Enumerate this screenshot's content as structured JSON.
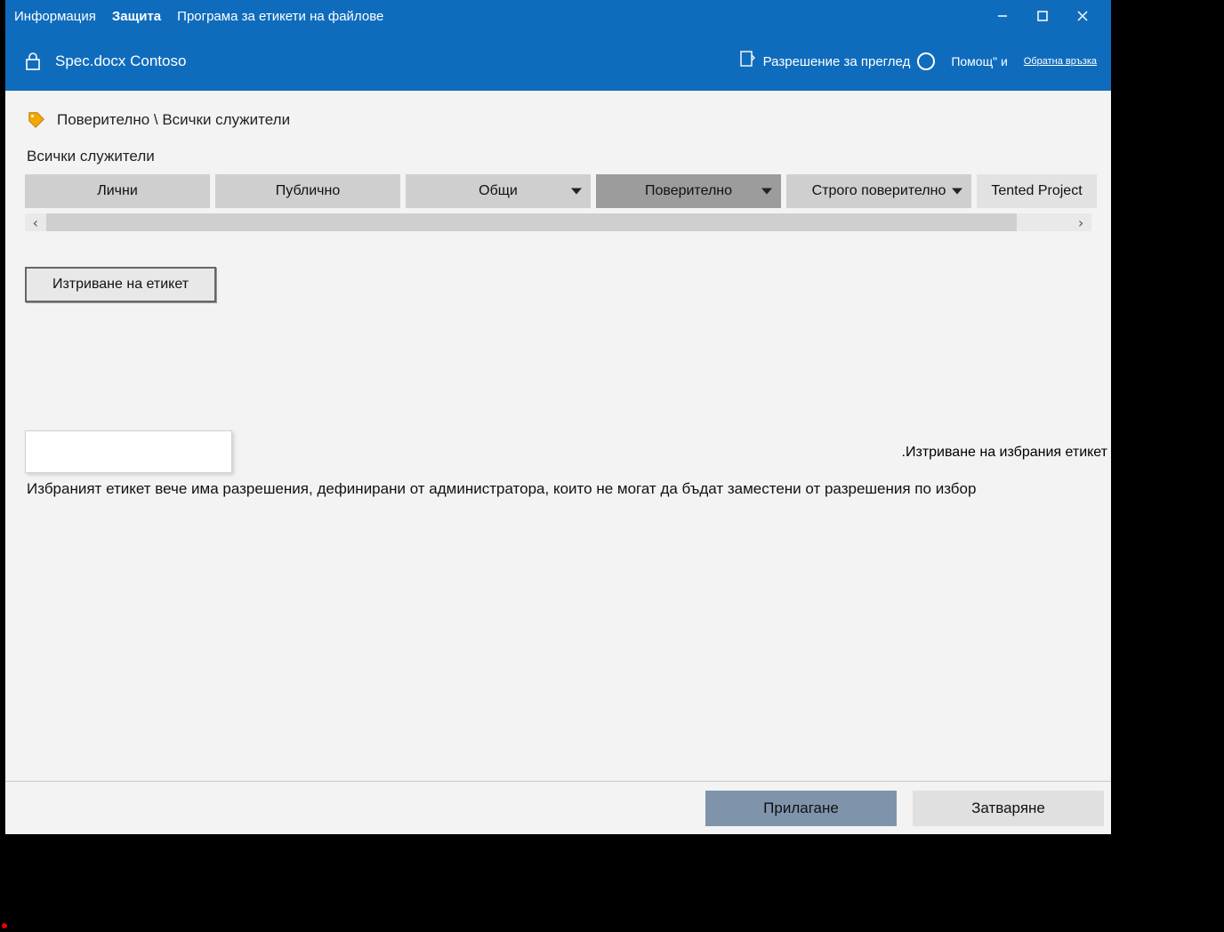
{
  "titlebar": {
    "menu": [
      "Информация",
      "Защита",
      "Програма за етикети на файлове"
    ],
    "active_index": 1
  },
  "subheader": {
    "filename": "Spec.docx Contoso",
    "view_permission": "Разрешение за преглед",
    "help": "Помощ\" и",
    "feedback": "Обратна връзка"
  },
  "breadcrumb": "Поверително \\ Всички служители",
  "section_label": "Всички служители",
  "labels": [
    {
      "text": "Лични",
      "has_caret": false,
      "selected": false
    },
    {
      "text": "Публично",
      "has_caret": false,
      "selected": false
    },
    {
      "text": "Общи",
      "has_caret": true,
      "selected": false
    },
    {
      "text": "Поверително",
      "has_caret": true,
      "selected": true
    },
    {
      "text": "Строго поверително",
      "has_caret": true,
      "selected": false
    },
    {
      "text": "Tented Project",
      "has_caret": false,
      "selected": false,
      "wproj": true
    }
  ],
  "delete_label_btn": "Изтриване на етикет",
  "tooltip_right": ".Изтриване на избрания етикет",
  "info_text": "Избраният етикет вече има разрешения, дефинирани от администратора, които не могат да бъдат заместени от разрешения по избор",
  "footer": {
    "apply": "Прилагане",
    "close": "Затваряне"
  }
}
